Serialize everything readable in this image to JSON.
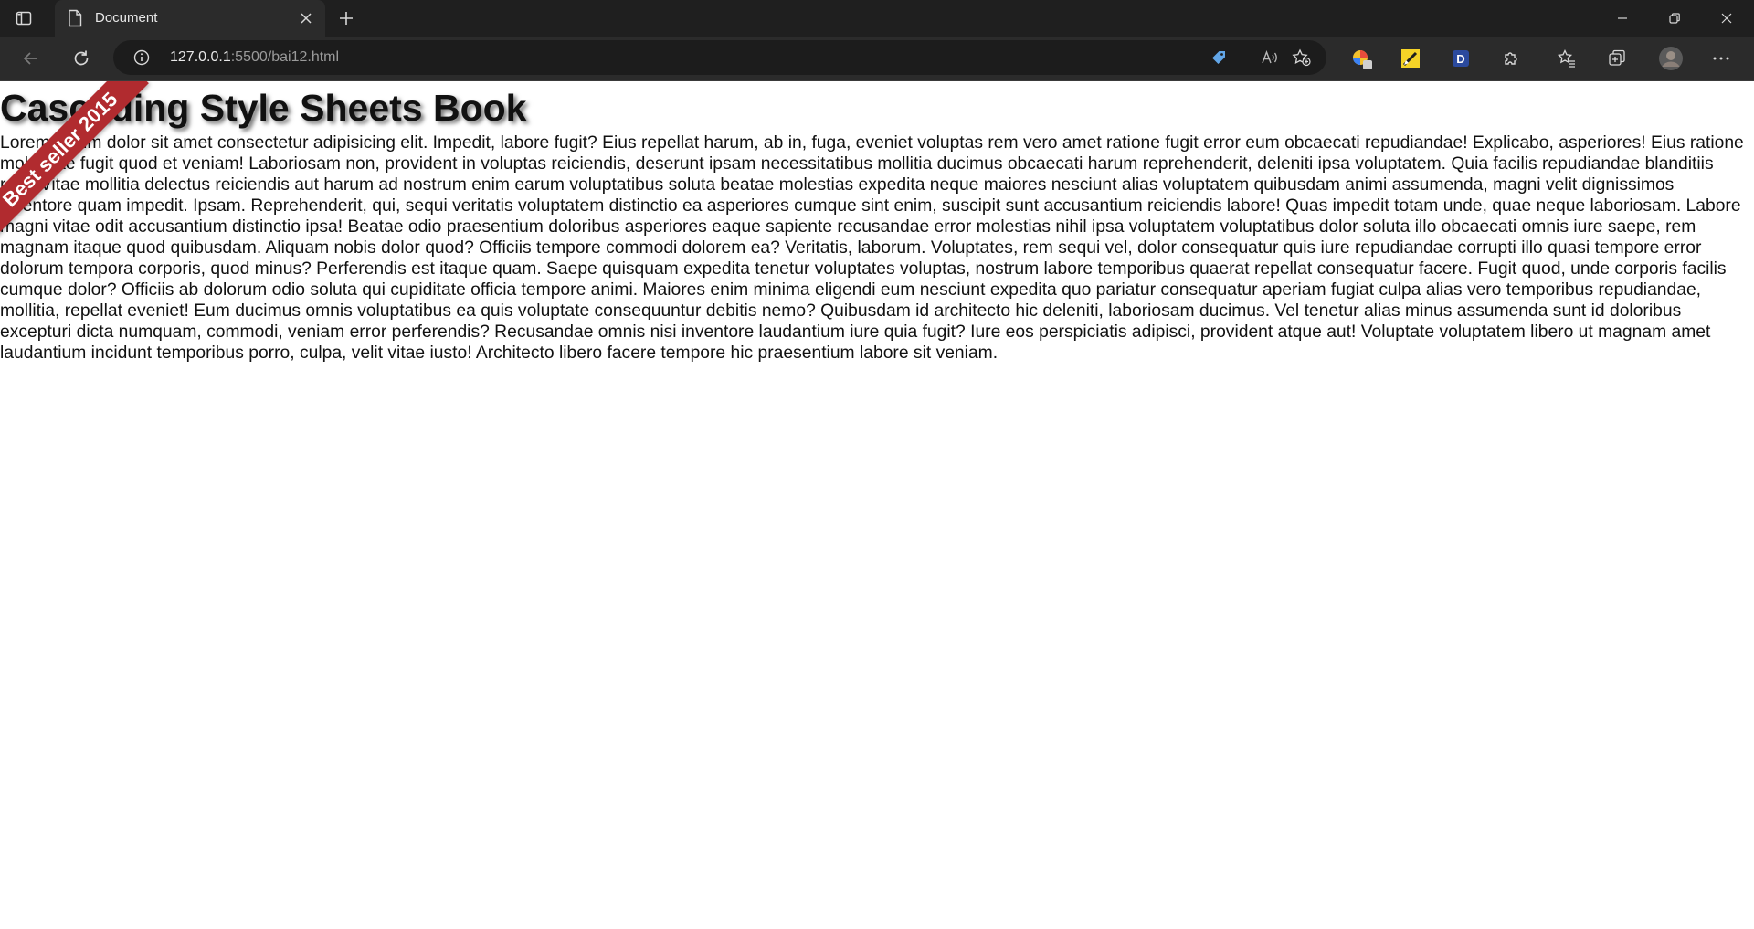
{
  "browser": {
    "tab_title": "Document",
    "url_host": "127.0.0.1",
    "url_path": ":5500/bai12.html",
    "extension_badge": "D"
  },
  "page": {
    "heading": "Cascading Style Sheets Book",
    "ribbon": "Best seller 2015",
    "paragraph": "Lorem ipsum dolor sit amet consectetur adipisicing elit. Impedit, labore fugit? Eius repellat harum, ab in, fuga, eveniet voluptas rem vero amet ratione fugit error eum obcaecati repudiandae! Explicabo, asperiores! Eius ratione molestiae fugit quod et veniam! Laboriosam non, provident in voluptas reiciendis, deserunt ipsam necessitatibus mollitia ducimus obcaecati harum reprehenderit, deleniti ipsa voluptatem. Quia facilis repudiandae blanditiis rem! Vitae mollitia delectus reiciendis aut harum ad nostrum enim earum voluptatibus soluta beatae molestias expedita neque maiores nesciunt alias voluptatem quibusdam animi assumenda, magni velit dignissimos inventore quam impedit. Ipsam. Reprehenderit, qui, sequi veritatis voluptatem distinctio ea asperiores cumque sint enim, suscipit sunt accusantium reiciendis labore! Quas impedit totam unde, quae neque laboriosam. Labore magni vitae odit accusantium distinctio ipsa! Beatae odio praesentium doloribus asperiores eaque sapiente recusandae error molestias nihil ipsa voluptatem voluptatibus dolor soluta illo obcaecati omnis iure saepe, rem magnam itaque quod quibusdam. Aliquam nobis dolor quod? Officiis tempore commodi dolorem ea? Veritatis, laborum. Voluptates, rem sequi vel, dolor consequatur quis iure repudiandae corrupti illo quasi tempore error dolorum tempora corporis, quod minus? Perferendis est itaque quam. Saepe quisquam expedita tenetur voluptates voluptas, nostrum labore temporibus quaerat repellat consequatur facere. Fugit quod, unde corporis facilis cumque dolor? Officiis ab dolorum odio soluta qui cupiditate officia tempore animi. Maiores enim minima eligendi eum nesciunt expedita quo pariatur consequatur aperiam fugiat culpa alias vero temporibus repudiandae, mollitia, repellat eveniet! Eum ducimus omnis voluptatibus ea quis voluptate consequuntur debitis nemo? Quibusdam id architecto hic deleniti, laboriosam ducimus. Vel tenetur alias minus assumenda sunt id doloribus excepturi dicta numquam, commodi, veniam error perferendis? Recusandae omnis nisi inventore laudantium iure quia fugit? Iure eos perspiciatis adipisci, provident atque aut! Voluptate voluptatem libero ut magnam amet laudantium incidunt temporibus porro, culpa, velit vitae iusto! Architecto libero facere tempore hic praesentium labore sit veniam."
  },
  "icons": {
    "tab_actions": "sidebar-toggle-icon",
    "tab": "document-icon",
    "close": "close-icon",
    "new_tab": "plus-icon",
    "minimize": "minimize-icon",
    "restore": "restore-icon",
    "window_close": "close-icon",
    "back": "back-arrow-icon",
    "refresh": "refresh-icon",
    "site_info": "info-icon",
    "coupon": "tag-icon",
    "read_aloud": "read-aloud-icon",
    "add_favorite": "star-plus-icon",
    "extensions": "puzzle-icon",
    "favorites": "favorites-icon",
    "collections": "collections-icon",
    "profile": "avatar",
    "more": "more-icon"
  },
  "colors": {
    "ribbon": "#b12b2f",
    "chrome_dark": "#1f1f1f",
    "toolbar": "#2b2b2b"
  }
}
